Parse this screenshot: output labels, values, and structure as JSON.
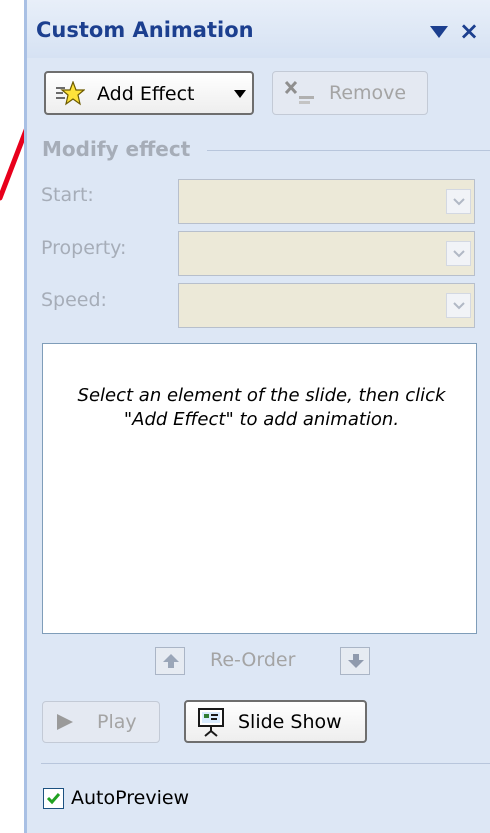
{
  "panel": {
    "title": "Custom Animation",
    "colors": {
      "title": "#1c3f8f",
      "panel_bg": "#dde7f5",
      "arrow": "#e8001c"
    }
  },
  "toolbar": {
    "add_effect_label": "Add Effect",
    "add_effect_icon": "star-icon",
    "remove_label": "Remove"
  },
  "modify": {
    "section_label": "Modify effect",
    "start_label": "Start:",
    "property_label": "Property:",
    "speed_label": "Speed:",
    "start_value": "",
    "property_value": "",
    "speed_value": ""
  },
  "list": {
    "hint": "Select an element of the slide, then click \"Add Effect\" to add animation."
  },
  "reorder": {
    "label": "Re-Order"
  },
  "playback": {
    "play_label": "Play",
    "slideshow_label": "Slide Show"
  },
  "options": {
    "autopreview_label": "AutoPreview",
    "autopreview_checked": true
  }
}
